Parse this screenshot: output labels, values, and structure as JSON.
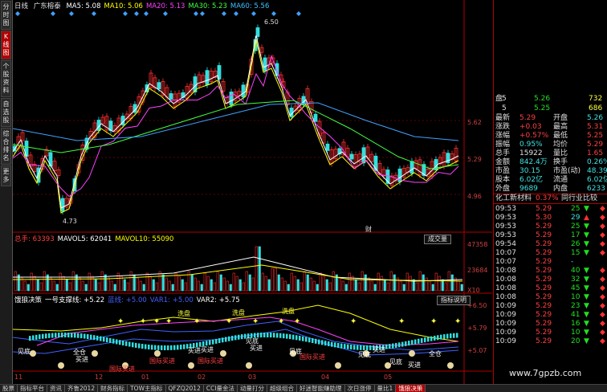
{
  "left_tabs": [
    "分时图",
    "K线图",
    "个股资料",
    "自选股",
    "综合排名",
    "更多"
  ],
  "header": {
    "period": "日线",
    "stock": "广东榕泰",
    "ma": [
      {
        "label": "MA5: 5.08",
        "color": "#ffffff"
      },
      {
        "label": "MA10: 5.06",
        "color": "#ffff00"
      },
      {
        "label": "MA20: 5.13",
        "color": "#ff40ff"
      },
      {
        "label": "MA30: 5.23",
        "color": "#40ff40"
      },
      {
        "label": "MA60: 5.56",
        "color": "#40c0ff"
      }
    ]
  },
  "price_axis": [
    "5.62",
    "5.29",
    "4.96"
  ],
  "price_high": "6.50",
  "price_low": "4.73",
  "cai_label": "财",
  "volume": {
    "header": [
      {
        "label": "总手: 63393",
        "color": "#ff4040"
      },
      {
        "label": "MAVOL5: 62041",
        "color": "#ffffff"
      },
      {
        "label": "MAVOL10: 55090",
        "color": "#ffff00"
      }
    ],
    "button": "成交量",
    "axis": [
      "47358",
      "23684",
      "X10"
    ]
  },
  "indicator": {
    "header": [
      {
        "label": "饿狼决策",
        "color": "#ffffff"
      },
      {
        "label": "一号支撑线: +5.22",
        "color": "#ffffff"
      },
      {
        "label": "蓝线: +5.00",
        "color": "#4060ff"
      },
      {
        "label": "VAR1: +5.00",
        "color": "#4060ff"
      },
      {
        "label": "VAR2: +5.75",
        "color": "#ffffff"
      }
    ],
    "button": "指标说明",
    "axis": [
      "+6.50",
      "+5.79",
      "+5.07"
    ],
    "labels": {
      "xipan": "洗盘",
      "jiandi": "见底",
      "quancang": "全仓",
      "maijin": "买进",
      "guoji": "国际买进"
    }
  },
  "x_axis": [
    "11",
    "12",
    "01",
    "02",
    "03",
    "04",
    "05"
  ],
  "quote": {
    "rows": [
      {
        "k1": "盘",
        "v1": "",
        "k2": "5",
        "v2": "5.26",
        "v3": "732"
      },
      {
        "k1": "",
        "v1": "",
        "k2": "5",
        "v2": "5.25",
        "v3": "686"
      },
      {
        "k1": "最新",
        "v1": "5.29",
        "k2": "开盘",
        "v2": "5.26"
      },
      {
        "k1": "涨跌",
        "v1": "+0.03",
        "k2": "最高",
        "v2": "5.31"
      },
      {
        "k1": "涨幅",
        "v1": "+0.57%",
        "k2": "最低",
        "v2": "5.25"
      },
      {
        "k1": "振幅",
        "v1": "0.95%",
        "k2": "均价",
        "v2": "5.29"
      },
      {
        "k1": "总手",
        "v1": "15922",
        "k2": "量比",
        "v2": "1.65"
      },
      {
        "k1": "金额",
        "v1": "842.4万",
        "k2": "换手",
        "v2": "0.26%"
      },
      {
        "k1": "市盈",
        "v1": "30.15",
        "k2": "市盈(动)",
        "v2": "48.39"
      },
      {
        "k1": "股本",
        "v1": "6.02亿",
        "k2": "流通",
        "v2": "6.02亿"
      },
      {
        "k1": "外盘",
        "v1": "9689",
        "k2": "内盘",
        "v2": "6233"
      }
    ],
    "sector": {
      "name": "化工新材料",
      "change": "0.37%",
      "link": "同行业比较"
    }
  },
  "ticks": [
    {
      "time": "09:53",
      "price": "5.29",
      "vol": "25",
      "dir": "down"
    },
    {
      "time": "09:53",
      "price": "5.30",
      "vol": "29",
      "dir": "up"
    },
    {
      "time": "09:53",
      "price": "5.29",
      "vol": "25",
      "dir": "down"
    },
    {
      "time": "09:53",
      "price": "5.29",
      "vol": "17",
      "dir": "down"
    },
    {
      "time": "09:54",
      "price": "5.29",
      "vol": "26",
      "dir": "down"
    },
    {
      "time": "10:07",
      "price": "5.29",
      "vol": "15",
      "dir": "down"
    },
    {
      "time": "10:07",
      "price": "5.29",
      "vol": "-",
      "dir": "none"
    },
    {
      "time": "10:08",
      "price": "5.29",
      "vol": "40",
      "dir": "down"
    },
    {
      "time": "10:08",
      "price": "5.29",
      "vol": "32",
      "dir": "down"
    },
    {
      "time": "10:08",
      "price": "5.29",
      "vol": "45",
      "dir": "down"
    },
    {
      "time": "10:08",
      "price": "5.29",
      "vol": "10",
      "dir": "down"
    },
    {
      "time": "10:09",
      "price": "5.29",
      "vol": "23",
      "dir": "down"
    },
    {
      "time": "10:09",
      "price": "5.29",
      "vol": "41",
      "dir": "down"
    },
    {
      "time": "10:09",
      "price": "5.29",
      "vol": "16",
      "dir": "down"
    },
    {
      "time": "10:09",
      "price": "5.29",
      "vol": "10",
      "dir": "down"
    },
    {
      "time": "10:09",
      "price": "5.29",
      "vol": "20",
      "dir": "down"
    }
  ],
  "bottom_tabs": [
    "股票",
    "指标平台",
    "资讯",
    "齐鲁2012",
    "财务指标",
    "TOW主指标",
    "QFZQ2012",
    "CCI量金法",
    "动量打分",
    "超级组合",
    "好迷智能赚助理",
    "次日涨停",
    "量比1",
    "饿狼决策"
  ],
  "watermark": "www.7gpzb.com",
  "colors": {
    "up": "#ff3030",
    "down": "#30e0e0",
    "accent": "#b00000"
  }
}
